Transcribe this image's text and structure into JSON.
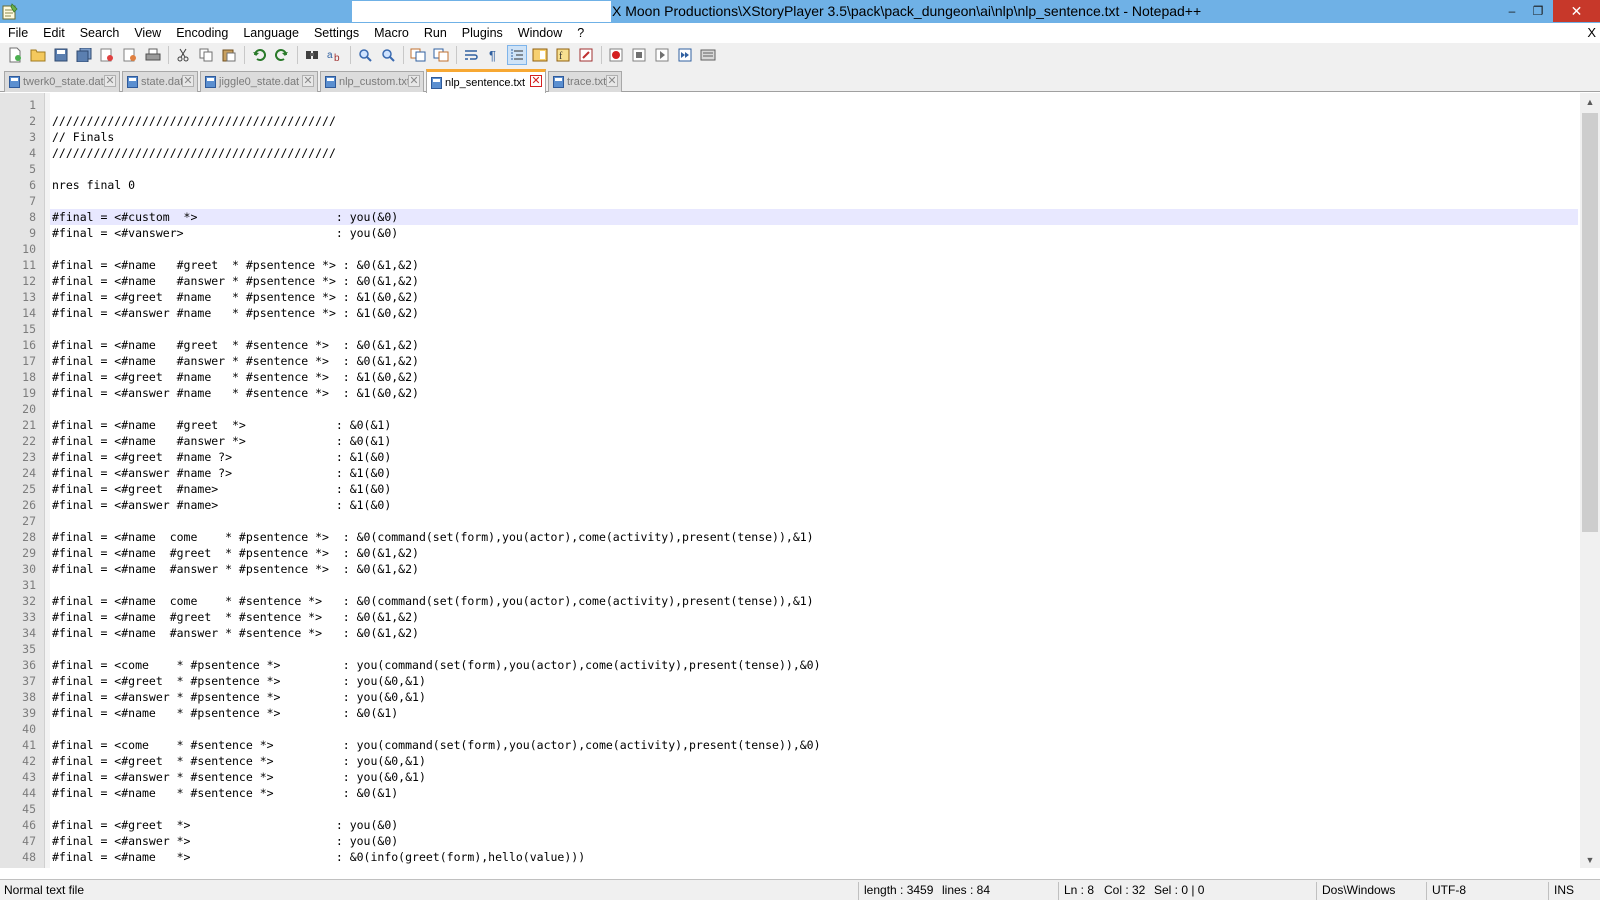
{
  "window": {
    "title": "X Moon Productions\\XStoryPlayer 3.5\\pack\\pack_dungeon\\ai\\nlp\\nlp_sentence.txt - Notepad++",
    "app_icon": "notepad-icon",
    "minimize": "–",
    "maximize": "❐",
    "close": "✕"
  },
  "menu": {
    "items": [
      "File",
      "Edit",
      "Search",
      "View",
      "Encoding",
      "Language",
      "Settings",
      "Macro",
      "Run",
      "Plugins",
      "Window",
      "?"
    ],
    "close_doc": "X"
  },
  "toolbar": {
    "buttons": [
      "new-file-icon",
      "open-file-icon",
      "save-icon",
      "save-all-icon",
      "close-icon",
      "close-all-icon",
      "print-icon",
      "cut-icon",
      "copy-icon",
      "paste-icon",
      "undo-icon",
      "redo-icon",
      "find-icon",
      "replace-icon",
      "zoom-in-icon",
      "zoom-out-icon",
      "sync-vertical-icon",
      "sync-horizontal-icon",
      "word-wrap-icon",
      "show-all-chars-icon",
      "indent-guide-icon",
      "document-map-icon",
      "function-list-icon",
      "folder-workspace-icon",
      "record-macro-icon",
      "stop-macro-icon",
      "play-macro-icon",
      "run-macro-multiple-icon",
      "save-macro-icon"
    ]
  },
  "tabs": [
    {
      "label": "twerk0_state.dat",
      "active": false
    },
    {
      "label": "state.dat",
      "active": false
    },
    {
      "label": "jiggle0_state.dat",
      "active": false
    },
    {
      "label": "nlp_custom.txt",
      "active": false
    },
    {
      "label": "nlp_sentence.txt",
      "active": true
    },
    {
      "label": "trace.txt",
      "active": false
    }
  ],
  "tab_close_glyph": "✕",
  "editor": {
    "current_line": 8,
    "lines": [
      "",
      "/////////////////////////////////////////",
      "// Finals",
      "/////////////////////////////////////////",
      "",
      "nres final 0",
      "",
      "#final = <#custom  *>                    : you(&0)",
      "#final = <#vanswer>                      : you(&0)",
      "",
      "#final = <#name   #greet  * #psentence *> : &0(&1,&2)",
      "#final = <#name   #answer * #psentence *> : &0(&1,&2)",
      "#final = <#greet  #name   * #psentence *> : &1(&0,&2)",
      "#final = <#answer #name   * #psentence *> : &1(&0,&2)",
      "",
      "#final = <#name   #greet  * #sentence *>  : &0(&1,&2)",
      "#final = <#name   #answer * #sentence *>  : &0(&1,&2)",
      "#final = <#greet  #name   * #sentence *>  : &1(&0,&2)",
      "#final = <#answer #name   * #sentence *>  : &1(&0,&2)",
      "",
      "#final = <#name   #greet  *>             : &0(&1)",
      "#final = <#name   #answer *>             : &0(&1)",
      "#final = <#greet  #name ?>               : &1(&0)",
      "#final = <#answer #name ?>               : &1(&0)",
      "#final = <#greet  #name>                 : &1(&0)",
      "#final = <#answer #name>                 : &1(&0)",
      "",
      "#final = <#name  come    * #psentence *>  : &0(command(set(form),you(actor),come(activity),present(tense)),&1)",
      "#final = <#name  #greet  * #psentence *>  : &0(&1,&2)",
      "#final = <#name  #answer * #psentence *>  : &0(&1,&2)",
      "",
      "#final = <#name  come    * #sentence *>   : &0(command(set(form),you(actor),come(activity),present(tense)),&1)",
      "#final = <#name  #greet  * #sentence *>   : &0(&1,&2)",
      "#final = <#name  #answer * #sentence *>   : &0(&1,&2)",
      "",
      "#final = <come    * #psentence *>         : you(command(set(form),you(actor),come(activity),present(tense)),&0)",
      "#final = <#greet  * #psentence *>         : you(&0,&1)",
      "#final = <#answer * #psentence *>         : you(&0,&1)",
      "#final = <#name   * #psentence *>         : &0(&1)",
      "",
      "#final = <come    * #sentence *>          : you(command(set(form),you(actor),come(activity),present(tense)),&0)",
      "#final = <#greet  * #sentence *>          : you(&0,&1)",
      "#final = <#answer * #sentence *>          : you(&0,&1)",
      "#final = <#name   * #sentence *>          : &0(&1)",
      "",
      "#final = <#greet  *>                     : you(&0)",
      "#final = <#answer *>                     : you(&0)",
      "#final = <#name   *>                     : &0(info(greet(form),hello(value)))",
      ""
    ]
  },
  "scrollbar": {
    "up": "▲",
    "down": "▼"
  },
  "status": {
    "file_type": "Normal text file",
    "length": "length : 3459",
    "lines": "lines : 84",
    "ln": "Ln : 8",
    "col": "Col : 32",
    "sel": "Sel : 0 | 0",
    "eol": "Dos\\Windows",
    "encoding": "UTF-8",
    "mode": "INS"
  },
  "colors": {
    "titlebar": "#6fb1e6",
    "close_button": "#c7382a",
    "active_tab_accent": "#f7a833",
    "current_line": "#e8e8ff",
    "gutter": "#e4e4e4"
  }
}
